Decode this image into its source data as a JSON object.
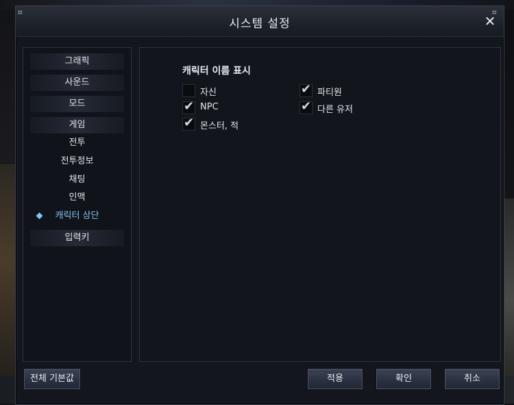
{
  "window": {
    "title": "시스템 설정"
  },
  "sidebar": {
    "categories": [
      {
        "label": "그래픽"
      },
      {
        "label": "사운드"
      },
      {
        "label": "모드"
      },
      {
        "label": "게임"
      }
    ],
    "subitems": [
      {
        "label": "전투"
      },
      {
        "label": "전투정보"
      },
      {
        "label": "채팅"
      },
      {
        "label": "인맥"
      },
      {
        "label": "캐릭터 상단",
        "active": true
      }
    ],
    "last_category": {
      "label": "입력키"
    }
  },
  "content": {
    "section_title": "캐릭터 이름 표시",
    "options": [
      {
        "label": "자신",
        "checked": false
      },
      {
        "label": "NPC",
        "checked": true
      },
      {
        "label": "몬스터, 적",
        "checked": true
      },
      {
        "label": "파티원",
        "checked": true
      },
      {
        "label": "다른 유저",
        "checked": true
      }
    ]
  },
  "footer": {
    "reset_label": "전체 기본값",
    "apply_label": "적용",
    "ok_label": "확인",
    "cancel_label": "취소"
  },
  "colors": {
    "accent": "#7ec6f0",
    "panel": "#12151c"
  }
}
